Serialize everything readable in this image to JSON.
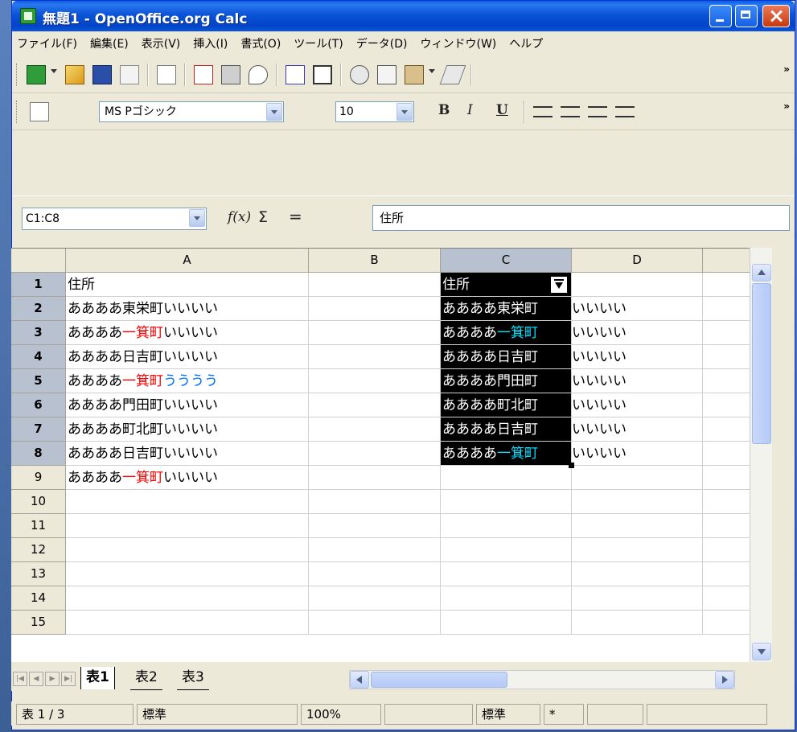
{
  "window": {
    "title": "無題1 - OpenOffice.org Calc"
  },
  "menu": [
    "ファイル(F)",
    "編集(E)",
    "表示(V)",
    "挿入(I)",
    "書式(O)",
    "ツール(T)",
    "データ(D)",
    "ウィンドウ(W)",
    "ヘルプ"
  ],
  "format_toolbar": {
    "font_name": "MS Pゴシック",
    "font_size": "10",
    "bold_label": "B",
    "italic_label": "I",
    "underline_label": "U"
  },
  "formula_bar": {
    "name_box": "C1:C8",
    "fx_label": "f(x)",
    "sum_label": "Σ",
    "equals_label": "=",
    "content": "住所"
  },
  "grid": {
    "columns": [
      "A",
      "B",
      "C",
      "D"
    ],
    "rows": [
      "1",
      "2",
      "3",
      "4",
      "5",
      "6",
      "7",
      "8",
      "9",
      "10",
      "11",
      "12",
      "13",
      "14",
      "15"
    ],
    "col_a": [
      [
        {
          "t": "住所"
        }
      ],
      [
        {
          "t": "ああああ東栄町いいいい"
        }
      ],
      [
        {
          "t": "ああああ"
        },
        {
          "t": "一箕町",
          "c": "red"
        },
        {
          "t": "いいいい"
        }
      ],
      [
        {
          "t": "ああああ日吉町いいいい"
        }
      ],
      [
        {
          "t": "ああああ"
        },
        {
          "t": "一箕町",
          "c": "red"
        },
        {
          "t": "うううう",
          "c": "blue"
        }
      ],
      [
        {
          "t": "ああああ門田町いいいい"
        }
      ],
      [
        {
          "t": "ああああ町北町いいいい"
        }
      ],
      [
        {
          "t": "ああああ日吉町いいいい"
        }
      ],
      [
        {
          "t": "ああああ"
        },
        {
          "t": "一箕町",
          "c": "red"
        },
        {
          "t": "いいいい"
        }
      ]
    ],
    "col_c": [
      {
        "inside": [
          {
            "t": "住所"
          }
        ],
        "overflow": ""
      },
      {
        "inside": [
          {
            "t": "ああああ東栄町"
          }
        ],
        "overflow": "いいいい"
      },
      {
        "inside": [
          {
            "t": "ああああ"
          },
          {
            "t": "一箕町",
            "c": "cyan"
          }
        ],
        "overflow": "いいいい"
      },
      {
        "inside": [
          {
            "t": "ああああ日吉町"
          }
        ],
        "overflow": "いいいい"
      },
      {
        "inside": [
          {
            "t": "ああああ門田町"
          }
        ],
        "overflow": "いいいい"
      },
      {
        "inside": [
          {
            "t": "ああああ町北町"
          }
        ],
        "overflow": "いいいい"
      },
      {
        "inside": [
          {
            "t": "ああああ日吉町"
          }
        ],
        "overflow": "いいいい"
      },
      {
        "inside": [
          {
            "t": "ああああ"
          },
          {
            "t": "一箕町",
            "c": "cyan"
          }
        ],
        "overflow": "いいいい"
      }
    ]
  },
  "sheet_tabs": [
    "表1",
    "表2",
    "表3"
  ],
  "status_bar": {
    "sheet": "表 1 / 3",
    "style": "標準",
    "zoom": "100%",
    "mode": "標準",
    "modified": "*"
  }
}
